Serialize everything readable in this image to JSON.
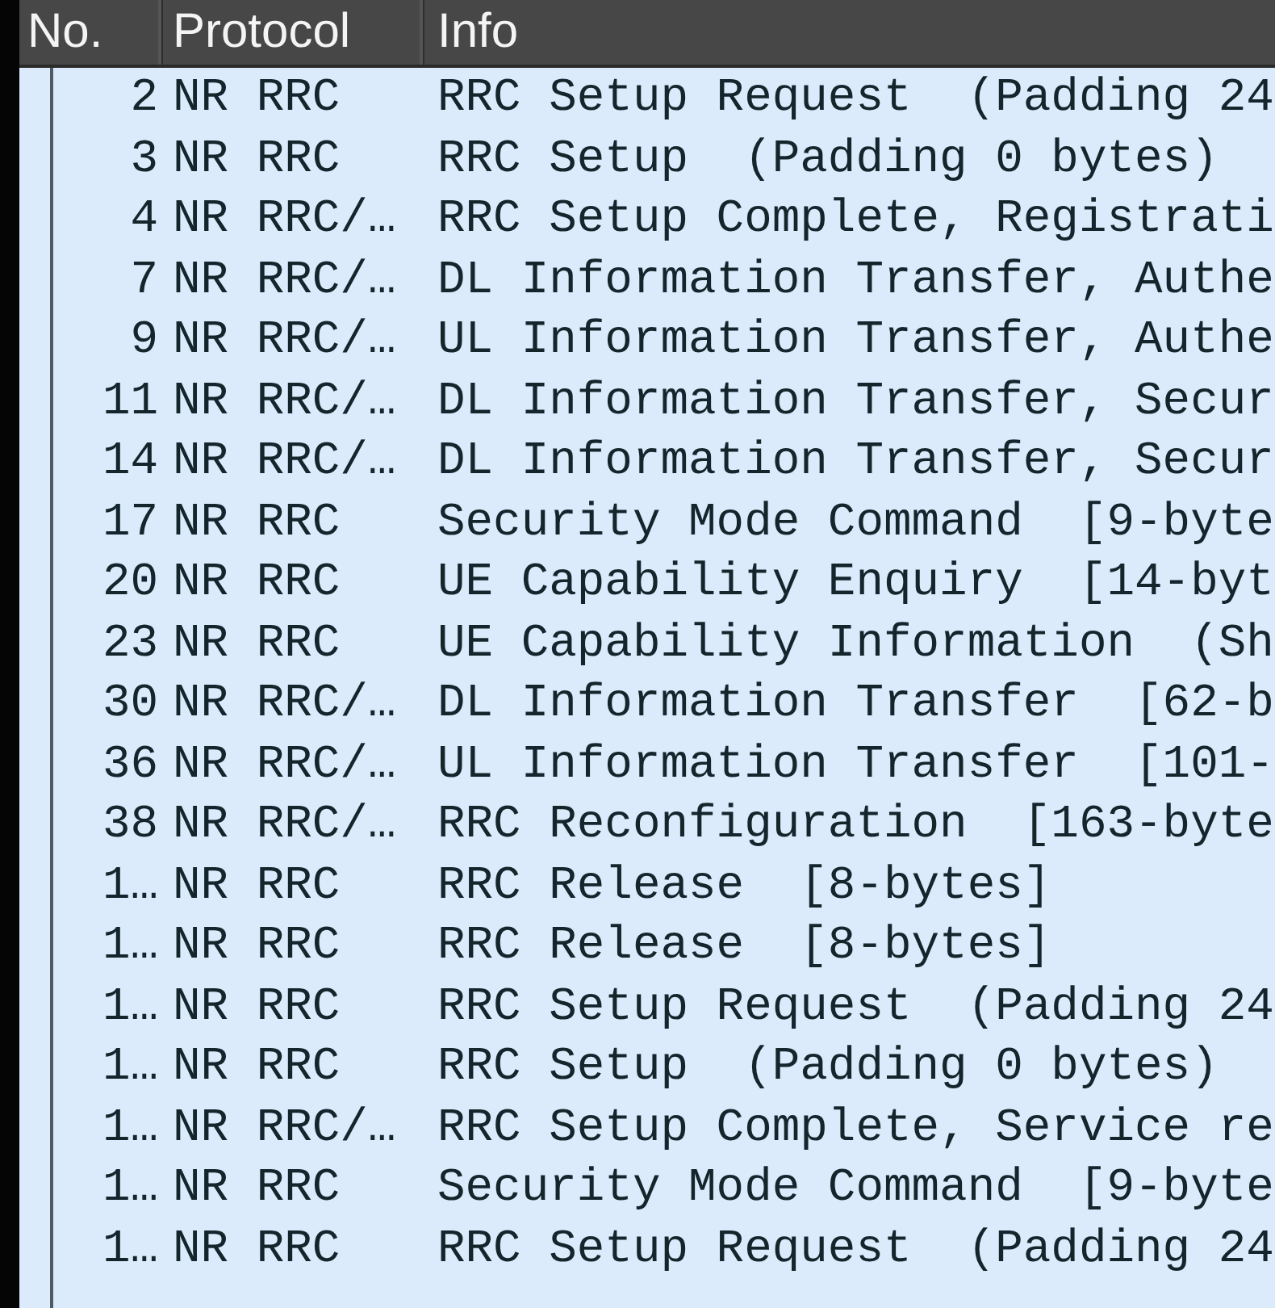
{
  "columns": [
    "No.",
    "Protocol",
    "Info"
  ],
  "rows": [
    {
      "no": "2",
      "protocol": "NR RRC",
      "info": "RRC Setup Request  (Padding 24",
      "selected": false
    },
    {
      "no": "3",
      "protocol": "NR RRC",
      "info": "RRC Setup  (Padding 0 bytes)",
      "selected": false
    },
    {
      "no": "4",
      "protocol": "NR RRC/…",
      "info": "RRC Setup Complete, Registrati",
      "selected": false
    },
    {
      "no": "7",
      "protocol": "NR RRC/…",
      "info": "DL Information Transfer, Authe",
      "selected": false
    },
    {
      "no": "9",
      "protocol": "NR RRC/…",
      "info": "UL Information Transfer, Authe",
      "selected": false
    },
    {
      "no": "11",
      "protocol": "NR RRC/…",
      "info": "DL Information Transfer, Secur",
      "selected": false
    },
    {
      "no": "14",
      "protocol": "NR RRC/…",
      "info": "DL Information Transfer, Secur",
      "selected": false
    },
    {
      "no": "17",
      "protocol": "NR RRC",
      "info": "Security Mode Command  [9-byte",
      "selected": false
    },
    {
      "no": "20",
      "protocol": "NR RRC",
      "info": "UE Capability Enquiry  [14-byt",
      "selected": false
    },
    {
      "no": "23",
      "protocol": "NR RRC",
      "info": "UE Capability Information  (Sh",
      "selected": false
    },
    {
      "no": "30",
      "protocol": "NR RRC/…",
      "info": "DL Information Transfer  [62-b",
      "selected": false
    },
    {
      "no": "36",
      "protocol": "NR RRC/…",
      "info": "UL Information Transfer  [101-",
      "selected": false
    },
    {
      "no": "38",
      "protocol": "NR RRC/…",
      "info": "RRC Reconfiguration  [163-byte",
      "selected": false
    },
    {
      "no": "1…",
      "protocol": "NR RRC",
      "info": "RRC Release  [8-bytes]",
      "selected": false
    },
    {
      "no": "1…",
      "protocol": "NR RRC",
      "info": "RRC Release  [8-bytes]",
      "selected": false
    },
    {
      "no": "1…",
      "protocol": "NR RRC",
      "info": "RRC Setup Request  (Padding 24",
      "selected": false
    },
    {
      "no": "1…",
      "protocol": "NR RRC",
      "info": "RRC Setup  (Padding 0 bytes)",
      "selected": false
    },
    {
      "no": "1…",
      "protocol": "NR RRC/…",
      "info": "RRC Setup Complete, Service re",
      "selected": false
    },
    {
      "no": "1…",
      "protocol": "NR RRC",
      "info": "Security Mode Command  [9-byte",
      "selected": false
    },
    {
      "no": "1…",
      "protocol": "NR RRC",
      "info": "RRC Setup Request  (Padding 24",
      "selected": false
    }
  ]
}
